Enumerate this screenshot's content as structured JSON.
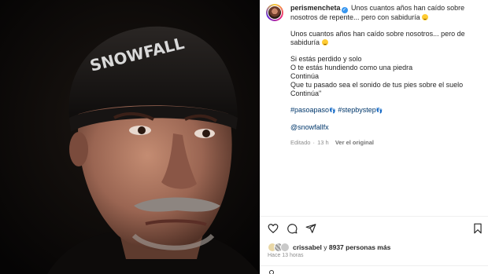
{
  "post": {
    "username": "perismencheta",
    "caption_first_line": "Unos cuantos años han caído sobre nosotros de repente... pero con sabiduría",
    "paragraph_1": "Unos cuantos años han caído sobre nosotros... pero de sabiduría",
    "lines": [
      "Si estás perdido y solo",
      "O te estás hundiendo como una piedra",
      "Continúa",
      "Que tu pasado sea el sonido de tus pies sobre el suelo",
      "Continúa\""
    ],
    "hashtags": [
      "#pasoapaso",
      "#stepbystep"
    ],
    "mention": "@snowfallfx",
    "edited_label": "Editado",
    "edited_time": "13 h",
    "see_original": "Ver el original"
  },
  "likes": {
    "liker": "crissabel",
    "connector": "y",
    "others": "8937 personas más"
  },
  "posted_ago": "Hace 13 horas",
  "photo": {
    "beanie_text": "SNOWFALL"
  },
  "icons": {
    "verified": "verified-badge-icon",
    "like": "heart-icon",
    "comment": "comment-icon",
    "share": "share-icon",
    "save": "bookmark-icon"
  },
  "colors": {
    "hashtag": "#00376b",
    "verified": "#3897f0",
    "muted": "#8e8e8e"
  }
}
